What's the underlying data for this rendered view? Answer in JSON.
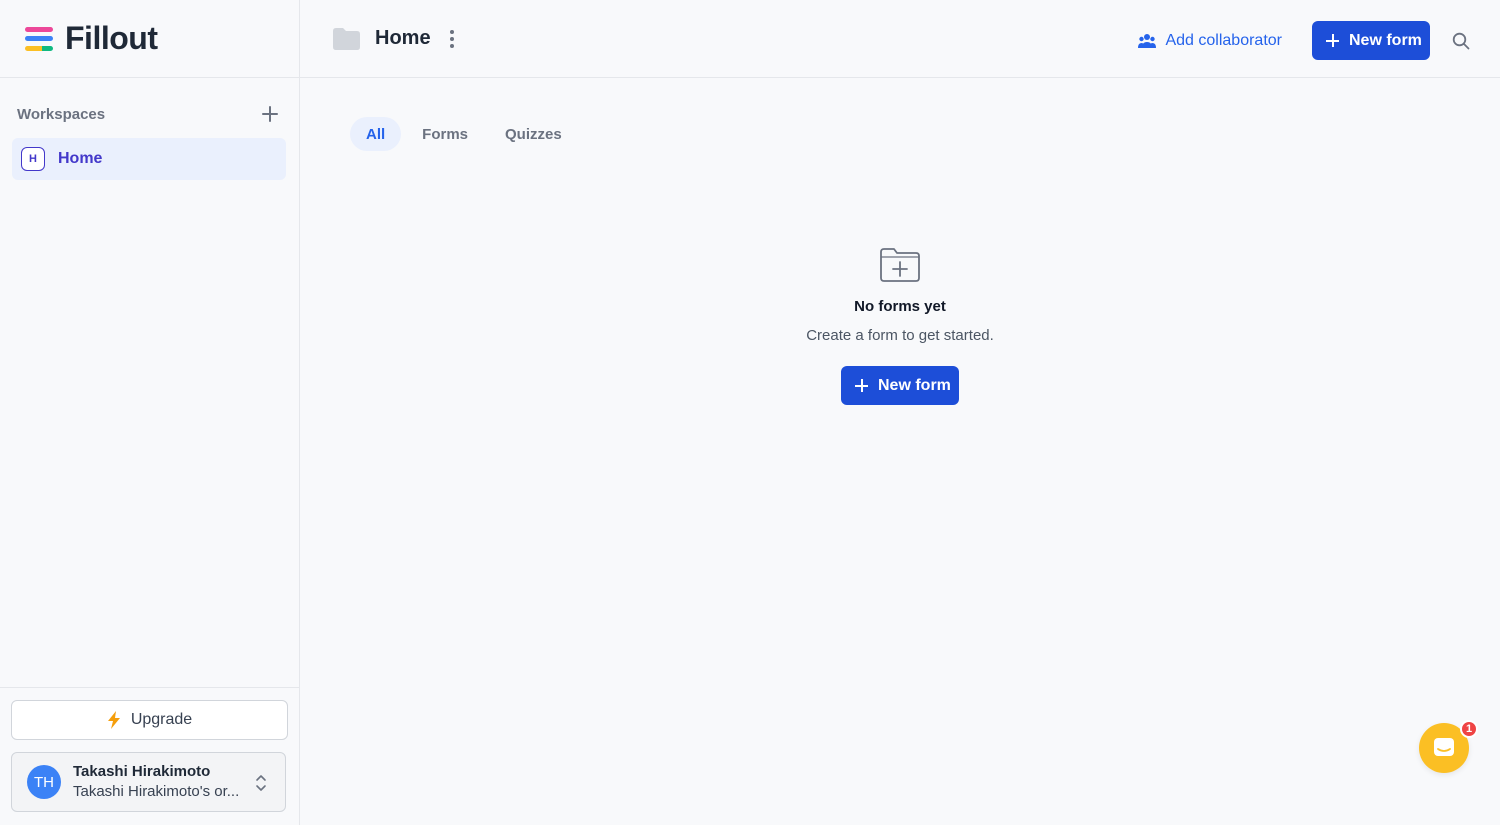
{
  "brand": {
    "name": "Fillout",
    "logo_colors": [
      "#ec4899",
      "#3b82f6",
      "#fbbf24",
      "#10b981"
    ]
  },
  "sidebar": {
    "workspaces_title": "Workspaces",
    "items": [
      {
        "badge": "H",
        "label": "Home",
        "active": true
      }
    ],
    "upgrade_label": "Upgrade",
    "user": {
      "initials": "TH",
      "name": "Takashi Hirakimoto",
      "org": "Takashi Hirakimoto's or..."
    }
  },
  "header": {
    "title": "Home",
    "add_collaborator": "Add collaborator",
    "new_form": "New form"
  },
  "tabs": [
    {
      "label": "All",
      "active": true
    },
    {
      "label": "Forms",
      "active": false
    },
    {
      "label": "Quizzes",
      "active": false
    }
  ],
  "empty_state": {
    "title": "No forms yet",
    "subtitle": "Create a form to get started.",
    "button": "New form"
  },
  "chat": {
    "badge_count": "1"
  },
  "colors": {
    "primary": "#1d4ed8",
    "accent_text": "#2563eb",
    "active_bg": "#eaf0fd",
    "chat": "#fbbf24",
    "badge": "#ef4444"
  }
}
